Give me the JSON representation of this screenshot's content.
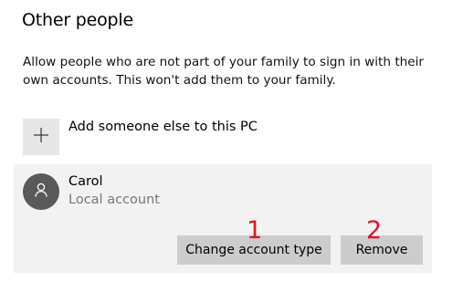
{
  "section": {
    "title": "Other people",
    "description": "Allow people who are not part of your family to sign in with their own accounts. This won't add them to your family."
  },
  "add_person": {
    "icon": "plus-icon",
    "label": "Add someone else to this PC"
  },
  "account": {
    "avatar_icon": "person-icon",
    "name": "Carol",
    "type": "Local account",
    "buttons": {
      "change_type": "Change account type",
      "remove": "Remove"
    }
  },
  "annotations": {
    "marker_1": "1",
    "marker_2": "2",
    "color": "#e81123"
  }
}
